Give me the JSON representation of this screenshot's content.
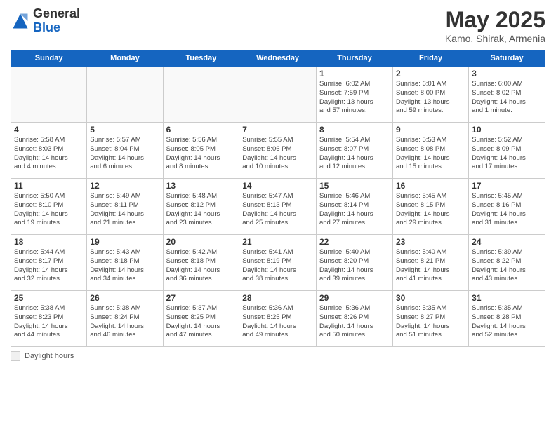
{
  "logo": {
    "general": "General",
    "blue": "Blue"
  },
  "title": "May 2025",
  "location": "Kamo, Shirak, Armenia",
  "days_header": [
    "Sunday",
    "Monday",
    "Tuesday",
    "Wednesday",
    "Thursday",
    "Friday",
    "Saturday"
  ],
  "legend_text": "Daylight hours",
  "weeks": [
    [
      {
        "day": "",
        "info": ""
      },
      {
        "day": "",
        "info": ""
      },
      {
        "day": "",
        "info": ""
      },
      {
        "day": "",
        "info": ""
      },
      {
        "day": "1",
        "info": "Sunrise: 6:02 AM\nSunset: 7:59 PM\nDaylight: 13 hours\nand 57 minutes."
      },
      {
        "day": "2",
        "info": "Sunrise: 6:01 AM\nSunset: 8:00 PM\nDaylight: 13 hours\nand 59 minutes."
      },
      {
        "day": "3",
        "info": "Sunrise: 6:00 AM\nSunset: 8:02 PM\nDaylight: 14 hours\nand 1 minute."
      }
    ],
    [
      {
        "day": "4",
        "info": "Sunrise: 5:58 AM\nSunset: 8:03 PM\nDaylight: 14 hours\nand 4 minutes."
      },
      {
        "day": "5",
        "info": "Sunrise: 5:57 AM\nSunset: 8:04 PM\nDaylight: 14 hours\nand 6 minutes."
      },
      {
        "day": "6",
        "info": "Sunrise: 5:56 AM\nSunset: 8:05 PM\nDaylight: 14 hours\nand 8 minutes."
      },
      {
        "day": "7",
        "info": "Sunrise: 5:55 AM\nSunset: 8:06 PM\nDaylight: 14 hours\nand 10 minutes."
      },
      {
        "day": "8",
        "info": "Sunrise: 5:54 AM\nSunset: 8:07 PM\nDaylight: 14 hours\nand 12 minutes."
      },
      {
        "day": "9",
        "info": "Sunrise: 5:53 AM\nSunset: 8:08 PM\nDaylight: 14 hours\nand 15 minutes."
      },
      {
        "day": "10",
        "info": "Sunrise: 5:52 AM\nSunset: 8:09 PM\nDaylight: 14 hours\nand 17 minutes."
      }
    ],
    [
      {
        "day": "11",
        "info": "Sunrise: 5:50 AM\nSunset: 8:10 PM\nDaylight: 14 hours\nand 19 minutes."
      },
      {
        "day": "12",
        "info": "Sunrise: 5:49 AM\nSunset: 8:11 PM\nDaylight: 14 hours\nand 21 minutes."
      },
      {
        "day": "13",
        "info": "Sunrise: 5:48 AM\nSunset: 8:12 PM\nDaylight: 14 hours\nand 23 minutes."
      },
      {
        "day": "14",
        "info": "Sunrise: 5:47 AM\nSunset: 8:13 PM\nDaylight: 14 hours\nand 25 minutes."
      },
      {
        "day": "15",
        "info": "Sunrise: 5:46 AM\nSunset: 8:14 PM\nDaylight: 14 hours\nand 27 minutes."
      },
      {
        "day": "16",
        "info": "Sunrise: 5:45 AM\nSunset: 8:15 PM\nDaylight: 14 hours\nand 29 minutes."
      },
      {
        "day": "17",
        "info": "Sunrise: 5:45 AM\nSunset: 8:16 PM\nDaylight: 14 hours\nand 31 minutes."
      }
    ],
    [
      {
        "day": "18",
        "info": "Sunrise: 5:44 AM\nSunset: 8:17 PM\nDaylight: 14 hours\nand 32 minutes."
      },
      {
        "day": "19",
        "info": "Sunrise: 5:43 AM\nSunset: 8:18 PM\nDaylight: 14 hours\nand 34 minutes."
      },
      {
        "day": "20",
        "info": "Sunrise: 5:42 AM\nSunset: 8:18 PM\nDaylight: 14 hours\nand 36 minutes."
      },
      {
        "day": "21",
        "info": "Sunrise: 5:41 AM\nSunset: 8:19 PM\nDaylight: 14 hours\nand 38 minutes."
      },
      {
        "day": "22",
        "info": "Sunrise: 5:40 AM\nSunset: 8:20 PM\nDaylight: 14 hours\nand 39 minutes."
      },
      {
        "day": "23",
        "info": "Sunrise: 5:40 AM\nSunset: 8:21 PM\nDaylight: 14 hours\nand 41 minutes."
      },
      {
        "day": "24",
        "info": "Sunrise: 5:39 AM\nSunset: 8:22 PM\nDaylight: 14 hours\nand 43 minutes."
      }
    ],
    [
      {
        "day": "25",
        "info": "Sunrise: 5:38 AM\nSunset: 8:23 PM\nDaylight: 14 hours\nand 44 minutes."
      },
      {
        "day": "26",
        "info": "Sunrise: 5:38 AM\nSunset: 8:24 PM\nDaylight: 14 hours\nand 46 minutes."
      },
      {
        "day": "27",
        "info": "Sunrise: 5:37 AM\nSunset: 8:25 PM\nDaylight: 14 hours\nand 47 minutes."
      },
      {
        "day": "28",
        "info": "Sunrise: 5:36 AM\nSunset: 8:25 PM\nDaylight: 14 hours\nand 49 minutes."
      },
      {
        "day": "29",
        "info": "Sunrise: 5:36 AM\nSunset: 8:26 PM\nDaylight: 14 hours\nand 50 minutes."
      },
      {
        "day": "30",
        "info": "Sunrise: 5:35 AM\nSunset: 8:27 PM\nDaylight: 14 hours\nand 51 minutes."
      },
      {
        "day": "31",
        "info": "Sunrise: 5:35 AM\nSunset: 8:28 PM\nDaylight: 14 hours\nand 52 minutes."
      }
    ]
  ]
}
